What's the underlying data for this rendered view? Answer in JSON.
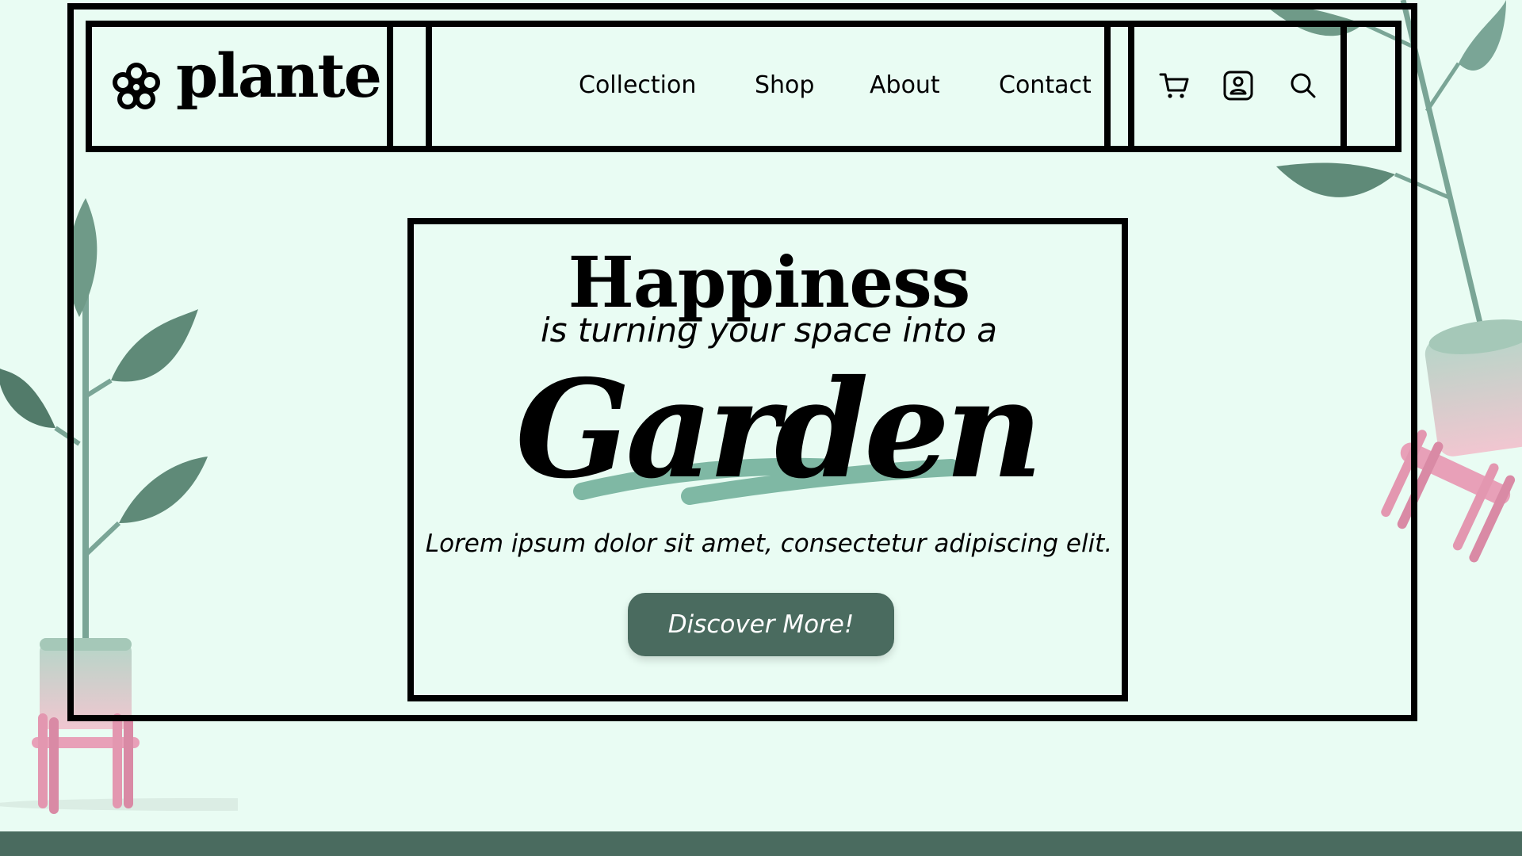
{
  "brand": {
    "name": "plante",
    "icon": "flower-icon"
  },
  "nav": {
    "links": [
      "Collection",
      "Shop",
      "About",
      "Contact"
    ]
  },
  "header_icons": [
    "cart-icon",
    "account-icon",
    "search-icon"
  ],
  "hero": {
    "title": "Happiness",
    "subtitle": "is turning your space into a",
    "highlight": "Garden",
    "description": "Lorem ipsum dolor sit amet, consectetur adipiscing elit.",
    "cta_label": "Discover More!"
  },
  "colors": {
    "background": "#e9fcf3",
    "accent": "#4a6b5f",
    "brush_stroke": "#7fb8a4",
    "leaf": "#6f9a88",
    "pot": "#f1c6d0",
    "stand": "#e8a0b8"
  }
}
